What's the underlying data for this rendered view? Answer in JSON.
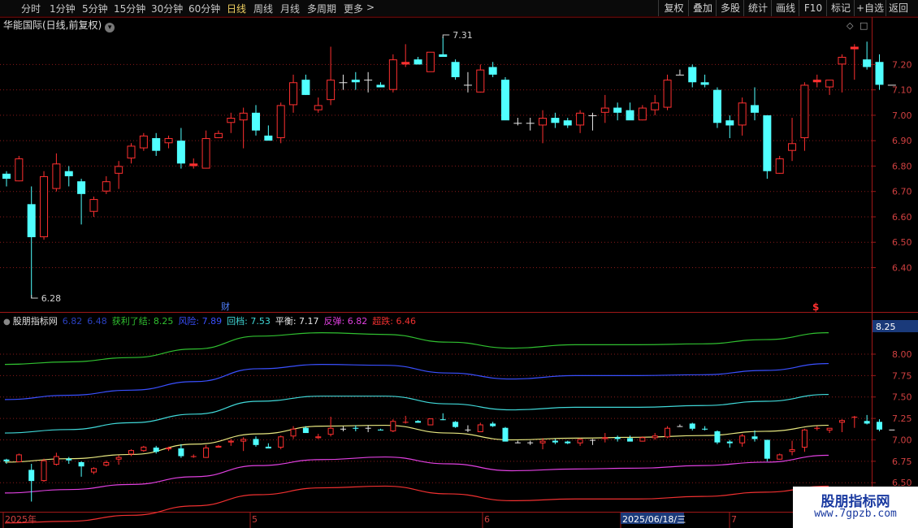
{
  "toolbar": {
    "periods": [
      {
        "label": "分时"
      },
      {
        "label": "1分钟"
      },
      {
        "label": "5分钟"
      },
      {
        "label": "15分钟"
      },
      {
        "label": "30分钟"
      },
      {
        "label": "60分钟"
      },
      {
        "label": "日线",
        "active": true
      },
      {
        "label": "周线"
      },
      {
        "label": "月线"
      },
      {
        "label": "多周期"
      },
      {
        "label": "更多"
      }
    ],
    "more_arrow": ">",
    "right_buttons": [
      "复权",
      "叠加",
      "多股",
      "统计",
      "画线",
      "F10",
      "标记",
      "+自选",
      "返回"
    ]
  },
  "main_title": "华能国际(日线,前复权)",
  "main_icons": {
    "diamond": "◇",
    "square": "□"
  },
  "indicator": {
    "name": "股朋指标网",
    "v1": "6.82",
    "v2": "6.48",
    "lines": [
      {
        "label": "获利了结",
        "value": "8.25",
        "color": "#30c030"
      },
      {
        "label": "风险",
        "value": "7.89",
        "color": "#3a50ff"
      },
      {
        "label": "回档",
        "value": "7.53",
        "color": "#40d8d8"
      },
      {
        "label": "平衡",
        "value": "7.17",
        "color": "#e8e8e8"
      },
      {
        "label": "反弹",
        "value": "6.82",
        "color": "#e040e0"
      },
      {
        "label": "超跌",
        "value": "6.46",
        "color": "#f03030"
      }
    ],
    "current_value": "8.25"
  },
  "markers": {
    "high": "7.31",
    "low": "6.28",
    "cai": "财",
    "dollar": "$"
  },
  "price_axis": [
    "7.20",
    "7.10",
    "7.00",
    "6.90",
    "6.80",
    "6.70",
    "6.60",
    "6.50",
    "6.40"
  ],
  "ind_axis": [
    "8.00",
    "7.75",
    "7.50",
    "7.25",
    "7.00",
    "6.75",
    "6.50"
  ],
  "date_axis": [
    "2025年",
    "5",
    "6",
    "2025/06/18/三",
    "7"
  ],
  "colors": {
    "up": "#ff3030",
    "down": "#50ffff",
    "grid": "#8a1a1a",
    "frame": "#a01818",
    "label": "#d04040"
  },
  "chart_data": {
    "type": "candlestick",
    "title": "华能国际(日线,前复权)",
    "candles": [
      [
        6.77,
        6.78,
        6.72,
        6.75
      ],
      [
        6.74,
        6.84,
        6.74,
        6.83
      ],
      [
        6.65,
        6.72,
        6.28,
        6.52
      ],
      [
        6.52,
        6.78,
        6.51,
        6.76
      ],
      [
        6.71,
        6.85,
        6.7,
        6.81
      ],
      [
        6.78,
        6.8,
        6.72,
        6.76
      ],
      [
        6.74,
        6.75,
        6.57,
        6.69
      ],
      [
        6.62,
        6.68,
        6.6,
        6.67
      ],
      [
        6.7,
        6.76,
        6.69,
        6.74
      ],
      [
        6.77,
        6.82,
        6.71,
        6.8
      ],
      [
        6.83,
        6.89,
        6.81,
        6.88
      ],
      [
        6.87,
        6.93,
        6.86,
        6.92
      ],
      [
        6.91,
        6.93,
        6.84,
        6.86
      ],
      [
        6.89,
        6.92,
        6.87,
        6.91
      ],
      [
        6.9,
        6.95,
        6.79,
        6.81
      ],
      [
        6.8,
        6.83,
        6.79,
        6.81
      ],
      [
        6.79,
        6.94,
        6.79,
        6.91
      ],
      [
        6.91,
        6.94,
        6.91,
        6.93
      ],
      [
        6.97,
        7.01,
        6.93,
        6.99
      ],
      [
        6.98,
        7.03,
        6.87,
        7.01
      ],
      [
        7.01,
        7.04,
        6.92,
        6.94
      ],
      [
        6.92,
        6.96,
        6.91,
        6.9
      ],
      [
        6.91,
        7.05,
        6.89,
        7.04
      ],
      [
        7.04,
        7.16,
        7.01,
        7.13
      ],
      [
        7.14,
        7.16,
        7.08,
        7.08
      ],
      [
        7.02,
        7.07,
        7.01,
        7.04
      ],
      [
        7.06,
        7.27,
        7.04,
        7.14
      ],
      [
        7.13,
        7.16,
        7.1,
        7.13
      ],
      [
        7.14,
        7.17,
        7.1,
        7.13
      ],
      [
        7.14,
        7.17,
        7.09,
        7.14
      ],
      [
        7.12,
        7.13,
        7.11,
        7.11
      ],
      [
        7.1,
        7.24,
        7.09,
        7.22
      ],
      [
        7.2,
        7.28,
        7.19,
        7.21
      ],
      [
        7.22,
        7.23,
        7.2,
        7.2
      ],
      [
        7.17,
        7.24,
        7.19,
        7.25
      ],
      [
        7.24,
        7.31,
        7.23,
        7.23
      ],
      [
        7.21,
        7.22,
        7.14,
        7.15
      ],
      [
        7.12,
        7.17,
        7.09,
        7.12
      ],
      [
        7.09,
        7.2,
        7.09,
        7.18
      ],
      [
        7.19,
        7.21,
        7.15,
        7.16
      ],
      [
        7.14,
        7.15,
        7.01,
        6.98
      ],
      [
        6.97,
        6.99,
        6.96,
        6.97
      ],
      [
        6.97,
        6.99,
        6.94,
        6.97
      ],
      [
        6.96,
        7.02,
        6.89,
        6.99
      ],
      [
        6.99,
        7.01,
        6.95,
        6.97
      ],
      [
        6.98,
        6.99,
        6.95,
        6.96
      ],
      [
        6.96,
        7.02,
        6.93,
        7.01
      ],
      [
        7.0,
        7.01,
        6.94,
        7.0
      ],
      [
        7.01,
        7.08,
        6.97,
        7.03
      ],
      [
        7.03,
        7.05,
        6.98,
        7.01
      ],
      [
        7.02,
        7.05,
        7.0,
        6.98
      ],
      [
        6.98,
        7.04,
        6.98,
        7.03
      ],
      [
        7.02,
        7.08,
        7.0,
        7.05
      ],
      [
        7.03,
        7.16,
        7.02,
        7.14
      ],
      [
        7.16,
        7.18,
        7.16,
        7.16
      ],
      [
        7.19,
        7.2,
        7.11,
        7.13
      ],
      [
        7.13,
        7.16,
        7.11,
        7.12
      ],
      [
        7.1,
        7.11,
        6.95,
        6.97
      ],
      [
        6.98,
        7.0,
        6.91,
        6.96
      ],
      [
        6.96,
        7.07,
        6.92,
        7.05
      ],
      [
        7.04,
        7.11,
        6.98,
        7.01
      ],
      [
        7.0,
        7.0,
        6.75,
        6.78
      ],
      [
        6.77,
        6.84,
        6.77,
        6.83
      ],
      [
        6.86,
        6.99,
        6.82,
        6.89
      ],
      [
        6.91,
        7.13,
        6.86,
        7.12
      ],
      [
        7.13,
        7.16,
        7.11,
        7.14
      ],
      [
        7.11,
        7.13,
        7.08,
        7.14
      ],
      [
        7.2,
        7.24,
        7.09,
        7.23
      ],
      [
        7.26,
        7.28,
        7.14,
        7.27
      ],
      [
        7.22,
        7.29,
        7.18,
        7.19
      ],
      [
        7.21,
        7.24,
        7.1,
        7.12
      ],
      [
        7.12,
        7.12,
        7.12,
        7.12
      ]
    ],
    "indicator_lines": {
      "获利了结": [
        7.88,
        7.91,
        7.96,
        8.06,
        8.21,
        8.25,
        8.23,
        8.14,
        8.07,
        8.11,
        8.11,
        8.12,
        8.17,
        8.25
      ],
      "风险": [
        7.47,
        7.52,
        7.58,
        7.68,
        7.83,
        7.88,
        7.87,
        7.78,
        7.71,
        7.75,
        7.75,
        7.76,
        7.81,
        7.89
      ],
      "回档": [
        7.08,
        7.12,
        7.2,
        7.3,
        7.45,
        7.51,
        7.51,
        7.42,
        7.35,
        7.38,
        7.38,
        7.4,
        7.45,
        7.53
      ],
      "平衡": [
        6.74,
        6.78,
        6.83,
        6.95,
        7.07,
        7.16,
        7.17,
        7.08,
        7.0,
        7.02,
        7.03,
        7.05,
        7.1,
        7.17
      ],
      "反弹": [
        6.38,
        6.42,
        6.48,
        6.57,
        6.7,
        6.77,
        6.8,
        6.72,
        6.64,
        6.66,
        6.67,
        6.7,
        6.74,
        6.82
      ],
      "超跌": [
        6.03,
        6.05,
        6.12,
        6.23,
        6.36,
        6.44,
        6.46,
        6.37,
        6.29,
        6.31,
        6.31,
        6.34,
        6.39,
        6.46
      ]
    },
    "main_ylim": [
      6.28,
      7.31
    ],
    "ind_ylim": [
      6.18,
      8.36
    ]
  }
}
